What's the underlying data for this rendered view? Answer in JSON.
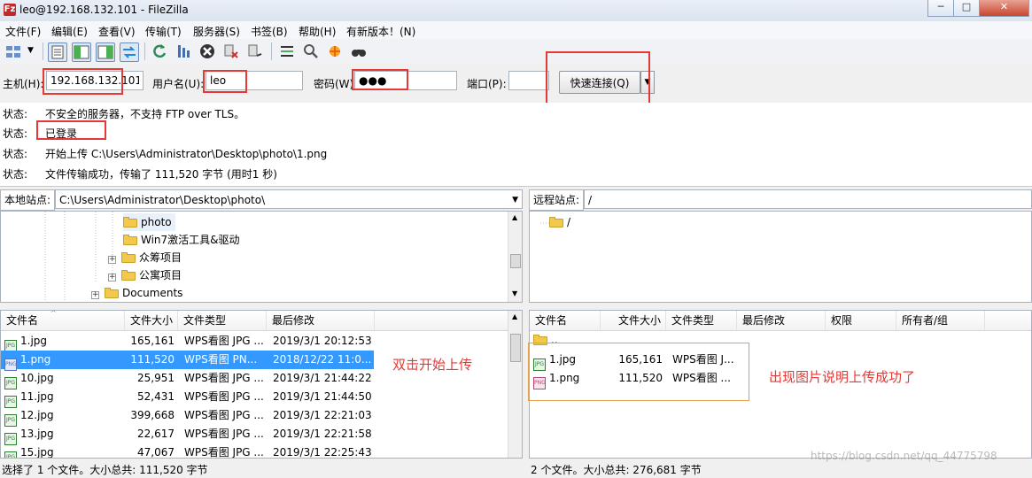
{
  "window": {
    "title": "leo@192.168.132.101 - FileZilla",
    "app_icon_letter": "Fz",
    "btn_min": "─",
    "btn_max": "□",
    "btn_close": "✕"
  },
  "menu": [
    {
      "label": "文件(F)"
    },
    {
      "label": "编辑(E)"
    },
    {
      "label": "查看(V)"
    },
    {
      "label": "传输(T)"
    },
    {
      "label": "服务器(S)"
    },
    {
      "label": "书签(B)"
    },
    {
      "label": "帮助(H)"
    },
    {
      "label": "有新版本！(N)"
    }
  ],
  "quickconnect": {
    "host_label": "主机(H):",
    "host_value": "192.168.132.101",
    "user_label": "用户名(U):",
    "user_value": "leo",
    "pass_label": "密码(W):",
    "pass_value": "●●●",
    "port_label": "端口(P):",
    "port_value": "",
    "button_label": "快速连接(Q)",
    "dropdown_glyph": "▼"
  },
  "log": [
    {
      "label": "状态:",
      "message": "不安全的服务器，不支持 FTP over TLS。"
    },
    {
      "label": "状态:",
      "message": "已登录"
    },
    {
      "label": "状态:",
      "message": "开始上传 C:\\Users\\Administrator\\Desktop\\photo\\1.png"
    },
    {
      "label": "状态:",
      "message": "文件传输成功，传输了 111,520 字节 (用时1 秒)"
    }
  ],
  "local": {
    "site_label": "本地站点:",
    "path": "C:\\Users\\Administrator\\Desktop\\photo\\",
    "tree": [
      {
        "name": "photo",
        "expander": ""
      },
      {
        "name": "Win7激活工具&驱动",
        "expander": ""
      },
      {
        "name": "众筹项目",
        "expander": "+"
      },
      {
        "name": "公寓项目",
        "expander": "+"
      },
      {
        "name": "Documents",
        "expander": "+"
      }
    ],
    "columns": {
      "name": "文件名",
      "size": "文件大小",
      "type": "文件类型",
      "modified": "最后修改"
    },
    "files": [
      {
        "name": "1.jpg",
        "size": "165,161",
        "type": "WPS看图 JPG ...",
        "modified": "2019/3/1 20:12:53",
        "icon": "jpg"
      },
      {
        "name": "1.png",
        "size": "111,520",
        "type": "WPS看图 PN...",
        "modified": "2018/12/22 11:0...",
        "icon": "png",
        "selected": true
      },
      {
        "name": "10.jpg",
        "size": "25,951",
        "type": "WPS看图 JPG ...",
        "modified": "2019/3/1 21:44:22",
        "icon": "jpg"
      },
      {
        "name": "11.jpg",
        "size": "52,431",
        "type": "WPS看图 JPG ...",
        "modified": "2019/3/1 21:44:50",
        "icon": "jpg"
      },
      {
        "name": "12.jpg",
        "size": "399,668",
        "type": "WPS看图 JPG ...",
        "modified": "2019/3/1 22:21:03",
        "icon": "jpg"
      },
      {
        "name": "13.jpg",
        "size": "22,617",
        "type": "WPS看图 JPG ...",
        "modified": "2019/3/1 22:21:58",
        "icon": "jpg"
      },
      {
        "name": "15.jpg",
        "size": "47,067",
        "type": "WPS看图 JPG ...",
        "modified": "2019/3/1 22:25:43",
        "icon": "jpg"
      }
    ],
    "status": "选择了 1 个文件。大小总共: 111,520 字节"
  },
  "remote": {
    "site_label": "远程站点:",
    "path": "/",
    "tree": [
      {
        "name": "/"
      }
    ],
    "columns": {
      "name": "文件名",
      "size": "文件大小",
      "type": "文件类型",
      "modified": "最后修改",
      "perms": "权限",
      "owner": "所有者/组"
    },
    "files": [
      {
        "name": "..",
        "size": "",
        "type": "",
        "icon": "folder"
      },
      {
        "name": "1.jpg",
        "size": "165,161",
        "type": "WPS看图 J...",
        "icon": "jpg"
      },
      {
        "name": "1.png",
        "size": "111,520",
        "type": "WPS看图 ...",
        "icon": "png"
      }
    ],
    "status": "2 个文件。大小总共: 276,681 字节"
  },
  "annotations": {
    "left": "双击开始上传",
    "right": "出现图片说明上传成功了"
  },
  "watermark": "https://blog.csdn.net/qq_44775798",
  "colors": {
    "selection": "#3399ff",
    "annotation_red": "#e53935"
  }
}
